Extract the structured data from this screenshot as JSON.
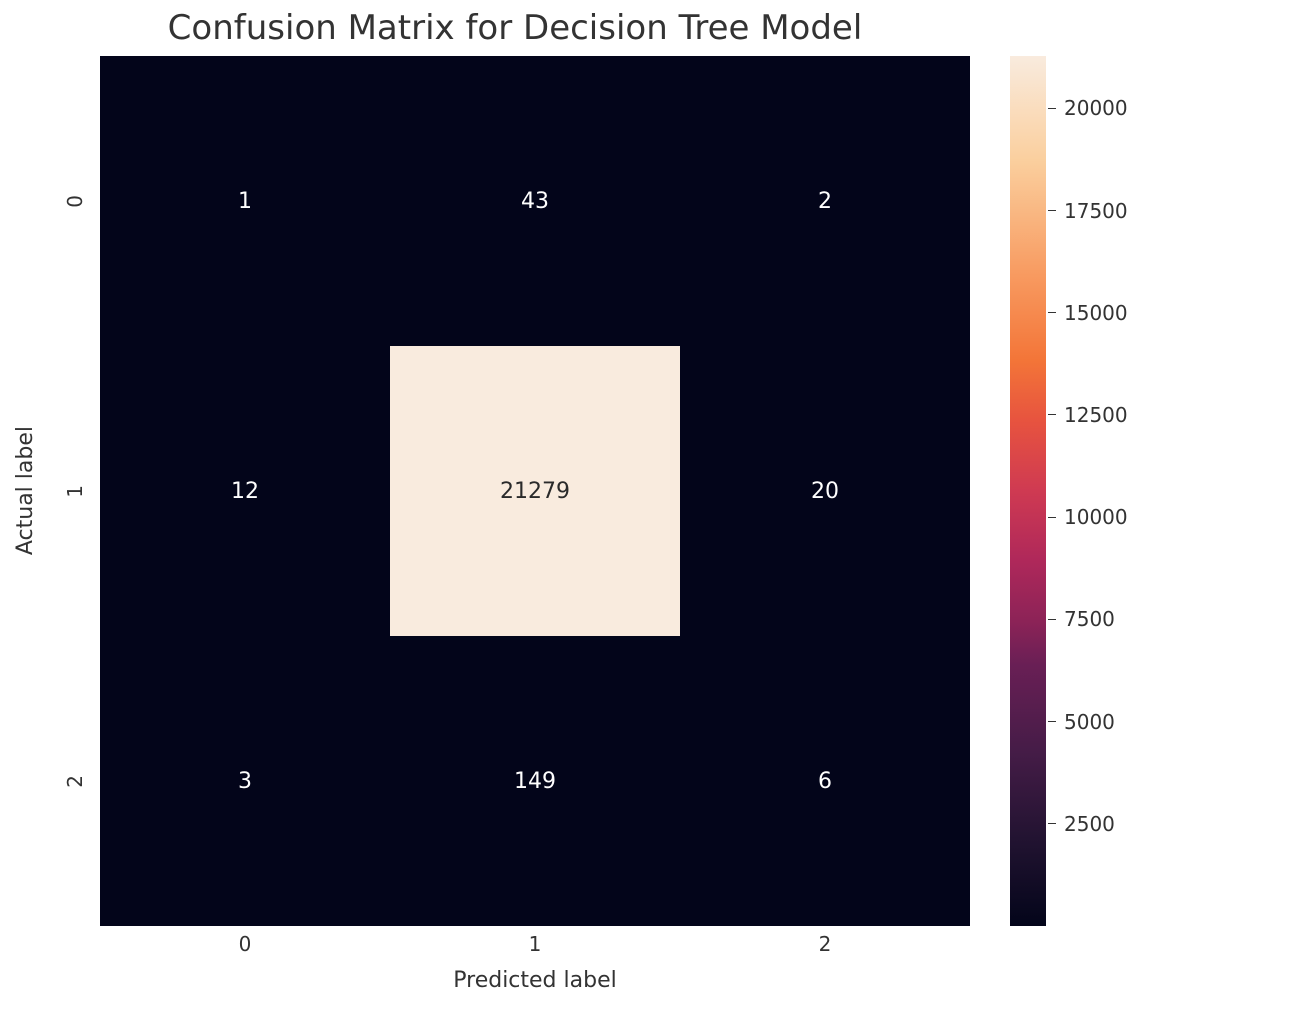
{
  "chart_data": {
    "type": "heatmap",
    "title": "Confusion Matrix for Decision Tree Model",
    "xlabel": "Predicted label",
    "ylabel": "Actual label",
    "x_categories": [
      "0",
      "1",
      "2"
    ],
    "y_categories": [
      "0",
      "1",
      "2"
    ],
    "values": [
      [
        1,
        43,
        2
      ],
      [
        12,
        21279,
        20
      ],
      [
        3,
        149,
        6
      ]
    ],
    "annotations": [
      [
        "1",
        "43",
        "2"
      ],
      [
        "12",
        "21279",
        "20"
      ],
      [
        "3",
        "149",
        "6"
      ]
    ],
    "cell_bg_colors": [
      [
        "#03051a",
        "#03051a",
        "#03051a"
      ],
      [
        "#03051a",
        "#f9ebde",
        "#03051a"
      ],
      [
        "#03051a",
        "#03051a",
        "#03051a"
      ]
    ],
    "cell_text_colors": [
      [
        "#ffffff",
        "#ffffff",
        "#ffffff"
      ],
      [
        "#ffffff",
        "#2a2a2a",
        "#ffffff"
      ],
      [
        "#ffffff",
        "#ffffff",
        "#ffffff"
      ]
    ],
    "colorbar": {
      "min": 0,
      "max": 21279,
      "ticks": [
        2500,
        5000,
        7500,
        10000,
        12500,
        15000,
        17500,
        20000
      ],
      "tick_labels": [
        "2500",
        "5000",
        "7500",
        "10000",
        "12500",
        "15000",
        "17500",
        "20000"
      ]
    }
  }
}
